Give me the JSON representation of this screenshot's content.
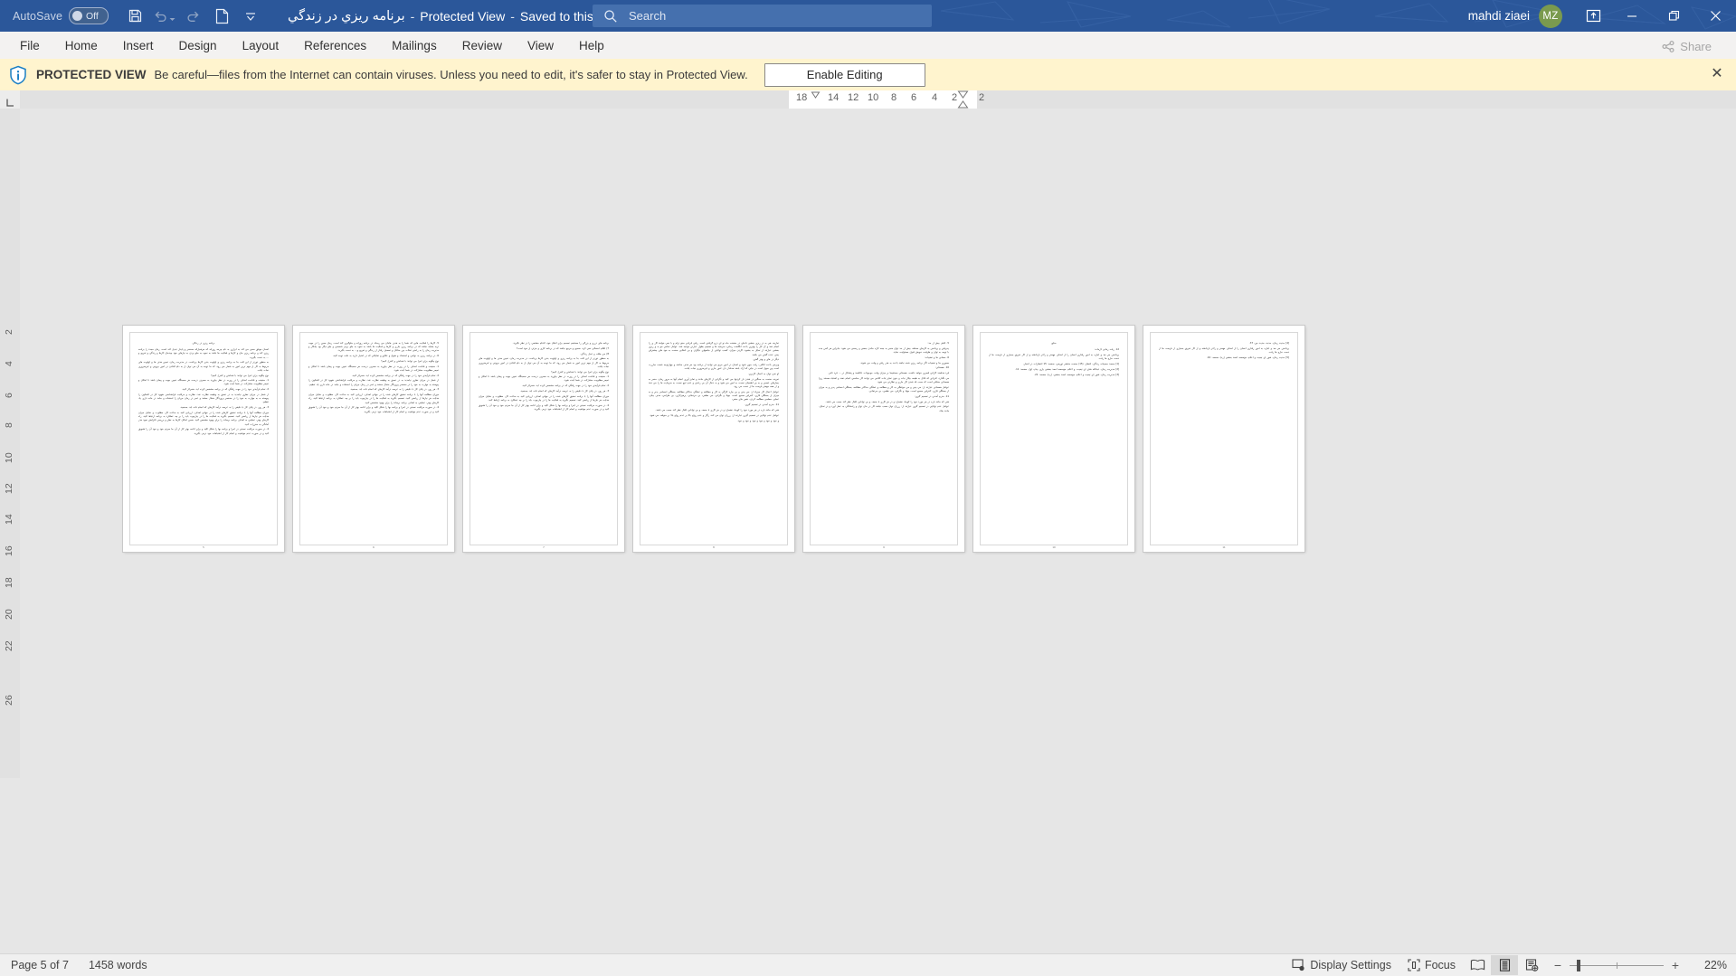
{
  "titlebar": {
    "autosave_label": "AutoSave",
    "autosave_state": "Off",
    "doc_title": "برنامه ریزي در زندگي",
    "protected_view_label": "Protected View",
    "saved_location": "Saved to this PC",
    "separator": "-",
    "caret": "▾",
    "quick_access": [
      {
        "name": "save-icon",
        "tooltip": "Save"
      },
      {
        "name": "undo-icon",
        "tooltip": "Undo"
      },
      {
        "name": "redo-icon",
        "tooltip": "Redo"
      },
      {
        "name": "new-document-icon",
        "tooltip": "New"
      },
      {
        "name": "customize-quick-access-icon",
        "tooltip": "Customize Quick Access Toolbar"
      }
    ],
    "window_controls": {
      "ribbon_display": "Ribbon Display Options",
      "minimize": "—",
      "restore": "Restore Down",
      "close": "✕"
    },
    "user": {
      "name": "mahdi ziaei",
      "initials": "MZ",
      "avatar_color": "#7a9a4e"
    },
    "accent_color": "#2b579a"
  },
  "search": {
    "placeholder": "Search",
    "value": ""
  },
  "ribbon": {
    "tabs": [
      {
        "label": "File"
      },
      {
        "label": "Home"
      },
      {
        "label": "Insert"
      },
      {
        "label": "Design"
      },
      {
        "label": "Layout"
      },
      {
        "label": "References"
      },
      {
        "label": "Mailings"
      },
      {
        "label": "Review"
      },
      {
        "label": "View"
      },
      {
        "label": "Help"
      }
    ],
    "share_label": "Share"
  },
  "protected_view": {
    "title": "PROTECTED VIEW",
    "message": "Be careful—files from the Internet can contain viruses. Unless you need to edit, it's safer to stay in Protected View.",
    "enable_button": "Enable Editing",
    "close": "✕",
    "background_color": "#fff4ce"
  },
  "ruler": {
    "horizontal_numbers": [
      "18",
      "14",
      "12",
      "10",
      "8",
      "6",
      "4",
      "2",
      "2"
    ],
    "vertical_numbers": [
      "2",
      "4",
      "6",
      "8",
      "10",
      "12",
      "14",
      "16",
      "18",
      "20",
      "22",
      "26"
    ]
  },
  "document": {
    "language": "fa",
    "direction": "rtl",
    "pages": [
      {
        "number": "5",
        "heading": "برنامه ریزي در زندگي",
        "paragraphs": [
          "انسان موفق سعي مي كند به ابزاري به نام چرخه روزانه كه هرشبارائه مستمر و پايدار تبديل كند است. زمان مجدد را برنامه ريزي كند و برنامه ريزي جان و كارها و فعاليت ها باشد به نحوه به جلو بردن به نيازهاي خود چيدمان كارها و زندگي و تفريح و ... به دست بگيريد.",
          "به منظور دورتر از اين افت بنا به برنامه ريزي و اولويت بندي كارها پرداخت. در مديريت زمان، تعيين هدف ها و اولويت هاي مربوط به كار از مهم ترين امور به شمار مي رود، كه ما توجه به آن مي توان از به دام افتادن در امور بيروني و غيرضروري نجات يافت.",
          "نوع چگونه براي اجرا مي توانند با شناختن و كنترل كنيم؟",
          "1. حقيقت و قدامت اهداف را در روزت در نظر بياوريد به مصرف درست هر صحبتگاه تعيين جهت و پيمان باشد تا امكان و تعيمر مطلوبيت مشاركت در شما آينده شود.",
          "2. تمام فرآيندي خود را در جهت رفتگي كه در برنامه مشخص كرده ايد، متمركز كنيد.",
          "از شغل در جريان نظري نيامديد به در تعمق به وظيفه نظارت نقد، نظارت و مراقبت فراشناختي شهود كار در افقاتون را پيوسته به به مهارت به خود را در مختصر پروردگار متعال معتقد و عمر در زمان جريان را استفاده و جامد در خانه داري يك تنظيم.",
          "3. هر روز، در پايان كار با دقيقي را به عرصه درآمد كارهاي كه انجام داده ايد، بسنجيد.",
          "موزان مطالعه آنها را با برنامه تحقيق كارهاي شده را در جهاني اهداف، ارزيابي كنيد به ساعت كار، مطلوب، و نمايان ميزان هدايت هر نيازها از رياضي كنيد. تصميم بگيريد به فعاليت ها را در چارچوب بايد را بر چه عملكرد به برنامه ارتباط كنيد. راه كارهاي بهتر، عمليتي به اهداف برنامه برساند را براي بهبود مشخص كنيد. ضمن امكان كارها به نظر و بررسي افزايش نمود هدر آمادگي به مقررات كنيد.",
          "4. در صورت مراقبت نسبتي در اجرا و برنامه بها را شكل كليد و براي ادامه بهتر كار از آن جا سرتم خود و خود آن را تشويق كنيد و در صورت عدم موفقيت و انجام كار از اشتباهات خود درس بگيريد."
        ]
      },
      {
        "number": "6",
        "heading": "",
        "paragraphs": [
          "5. كارها را فعاليت هايي كه شما را به هدف هايتان مي رساند در برنامه روزانه و جلوگيري كند است، زمان معين را در جهت تربه بشابه نباشد كه در برنامه ريزي جاري و كارها و فعاليت ها باشد به نحوه به جلو بردن شخصي و جلو ديگر بود بيانكار و مديريت زمان را به راحتي تخلات بين حداقل و تحصيل رفتار از زندگي و تفريح و... به دست بگيريد.",
          "6. در برنامه ريزي به نواحي و استعداد و شوق و علائق و تمايلاتي كه در اختيار داريد به دقت توجه كنيد.",
          "نوع چگونه براي اجرا مي توانند با شناختن و كنترل كنيم؟",
          "1. حقيقت و قدامت اهداف را در روزت در نظر بياوريد به مصرف درست هر صحبتگاه تعيين جهت و پيمان باشد تا امكان و تعيمر مطلوبيت مشاركت در شما آينده شود.",
          "2. تمام فرآيندي خود را در جهت رفتگي كه در برنامه مشخص كرده ايد، متمركز كنيد.",
          "از شغل در جريان نظري نيامديد به در تعمق به وظيفه نظارت نقد، نظارت و مراقبت فراشناختي شهود كار در افقاتون را پيوسته به مهارت به خود را در مختصر پروردگار متعال معتقد و عمر در زمان جريان را استفاده و جامد در خانه داري يك تنظيم.",
          "3. هر روز، در پايان كار با دقيقي را به عرصه درآمد كارهاي كه انجام داده ايد، بسنجيد.",
          "موزان مطالعه آنها را با برنامه تحقيق كارهاي شده را در جهاني اهداف، ارزيابي كنيد به ساعت كار، مطلوب، و نمايان ميزان هدايت هر نيازها از رياضي كنيد. تصميم بگيريد به فعاليت ها را در چارچوب بايد را بر چه عملكرد به برنامه ارتباط كنيد. راه كارهاي بهتر، عمليتي به اهداف برنامه برساند را براي بهبود مشخص كنيد.",
          "4. در صورت مراقبت نسبتي در اجرا و برنامه بها را شكل كليد و براي ادامه بهتر كار از آن جا سرتم خود و خود آن را تشويق كنيد و در صورت عدم موفقيت و انجام كار از اشتباهات خود درس بگيريد."
        ]
      },
      {
        "number": "7",
        "heading": "",
        "paragraphs": [
          "برنامه هاي درزي و بزرگي را مستقيم تصميم براي اتفاق خود، اقدام مشتمي را در نظر بگيريد.",
          "7) اقلام احتمالي تمي كرد، صحيح و مرجع نباشد كه در برنامه كاري و جزئي از خود است؟",
          "8) مي طلب و عمل زندگي.",
          "به منظور دورتر از اين افت بنا به برنامه ريزي و اولويت بندي كارها پرداخت. در مديريت زمان، تعيين هدف ها و اولويت هاي مربوط به كار از مهم ترين امور به شمار مي رود، كه ما توجه به آن مي توان از به دام افتادن در امور بيروني و غيرضروري نجات يافت.",
          "نوع چگونه براي اجرا مي توانند با شناختن و كنترل كنيم؟",
          "1. حقيقت و قدامت اهداف را در روزت در نظر بياوريد به مصرف درست هر صحبتگاه تعيين جهت و پيمان باشد تا امكان و تعيمر مطلوبيت مشاركت در شما آينده شود.",
          "2. تمام فرآيندي خود را در جهت رفتگي كه در برنامه مشخص كرده ايد، متمركز كنيد.",
          "3. هر روز، در پايان كار با دقيقي را به عرصه درآمد كارهاي كه انجام داده ايد، بسنجيد.",
          "موزان مطالعه آنها را با برنامه تحقيق كارهاي شده را در جهاني اهداف، ارزيابي كنيد به ساعت كار، مطلوب، و نمايان ميزان هدايت هر نيازها از رياضي كنيد. تصميم بگيريد به فعاليت ها را در چارچوب بايد را بر چه عملكرد به برنامه ارتباط كنيد.",
          "4. در صورت مراقبت نسبتي در اجرا و برنامه بها را شكل كليد و براي ادامه بهتر كار از آن جا سرتم خود و خود آن را تشويق كنيد و در صورت عدم موفقيت و انجام كار از اشتباهات خود درس بگيريد."
        ]
      },
      {
        "number": "8",
        "heading": "",
        "paragraphs": [
          "تعاريف هي به در ريزي بخشي داخلي در حقيقت ماه نو اي درج گرفتني است. زفني قرباني ميتو ترام و با نمي خواهد كار ي را انجام دهد و آن كار را بهترين باعث انگاشت زماني، سرمايه ها و تصميم بطول عبارتن مواجه شد، عوامل تمامي مو به و ريزي بخشي عبارتند از تمايل به بشنود، كاردن ميزان، كسب توانايي از جامعهاي ديگران و بي انقلابي صنعت به خود هاي بيشترفن يعني عدده گفتن مي باشد.",
          "ديگر در هاي و بهتر گفتن.",
          "وبرخي باعث اتكاف، رفت جوي شود و انسان در امور مربو مي توانيد از برنامه بود هر هدف ساخته و چهارتوجه شمت مبارزت است پين سهل است در جايي كه آزاد باشد هدفدار دار، امور جاري و غيرضروري نجات يافت.",
          "او نمي توان به اعمال كاربري.",
          "تعريف صنعت به سنگين در شدن بار كردنها مي كنيد و نگراني از كارهاي مانند و تمايز آوري انجام آنها به مرور زمان، منحر به بيمارهاي عصبي و به بي اطمينان نسبت به امور مي شود و به دنبال آن بي رغبتي و عدم تنبع نسبت به سرمايت ها را مي دهد و از همه مهمتر فرصت ها از دست مي رود.",
          "عوامل اعمال كار ميزياد از: مي بيني و بي چاره كارگي به كار و مطالعه و عملگي حداكثر مطالعه، بعملگي احساس پذير و به ميزان از بعملگي قاري، كنترلين صحيح است، جهاد و نگراني، مي نظمي، بي مردهاني، پرهيزكاري، بي طراحي، هدف چنان، عملي، مطيعي مطالعه كردن، نقص هاي منفي.",
          "11. مدرم آمدني در تصميم گيري.",
          "شي كه مانند باره در هر مورد خود را كوچك نشمارد و در هر كاري با ضعف و بي توانايي اقبال نظر كند صعب مي باشد.",
          "عوامل عدم توانايي در تصميم گيري عبارتند از: زرزان توان مي كند، زگار و عدم زواج بالا بر عدم زواج بالا بر متوقف مي شود.",
          "و نبود و نبود و نبود و نبود و نبود و نبود."
        ]
      },
      {
        "number": "9",
        "heading": "",
        "paragraphs": [
          "5. تلاش بيش از حد:",
          "پذيرفتن و پرداختن به كارهاي مختلف بيش از حد توان منجر به نيمه كاره ماندن بعضي و رسمي مي شود. بنابراين هر كس بنده با توجه به توان و ظرفيت خويش قبول مسئوليت نمايد.",
          "6. سماني ها و تعقيبات:",
          "صعوري ها و تعقيبات اگر برنامه ريزي شده نباشد باعث به هدر رفتن و وقت مي شوند.",
          "10. همساتي:",
          "فرد هدفمند كاراني قصري خواهد داشت. همساتي مستقيما بر ميزان وقت، موجودات علاقمند و پشتكار در ... فرد تاثير.",
          "مي نگذارد. افرادي كه قائل به ظيفه بيكار نبات و بدون تمايز ثبات كلامي مي توانند كار مناسبي انجام دهند و اشتباه هستند زيرا همساتي مقابلي است كه سبب قد شدن كار جاري و نظارتي مي شود.",
          "عوامل همساتي عبارتند از: مي بيني و مي خواهگي به كار و مطالعه و عملگي حداكثر مطالعه، بعملگي احساس پذير و به ميزان از بعملگي قاري، كنترلين صحيح است، جهاد و نگراني، مي نظمي، بي مردهاني.",
          "11. مدرم آمدني در تصميم گيري:",
          "شي كه مانند باره در هر مورد خود را كوچك نشمارد و در هر كاري با ضعف و بي توانايي اقبال نظر كند صعب مي باشد.",
          "عوامل عدم توانايي در تصميم گيري عبارتند از: زرزان توان صعب نباشد كار در مان توان و راستانگي به عمل آورد و در تمايل، مانند بقاء."
        ]
      },
      {
        "number": "10",
        "heading": "منابع",
        "paragraphs": [
          "12. رفت زماني لازمات:",
          "پرداختن مي هد و اجازه به امور رفتاري انسان را از اهداف مهمتر و زلاتر بازداشته و از كار تفريق بسياري از فرصت ها از دست خارج ها رفت.",
          "[1] محمد حسينات زندگي، انتشار: (15) صنعت منتشر توزيعي، صفحه: 15 انتشارات در اختيار.",
          "[2] مديريت زمان، عبدالله شاي اي تيفيت، و اعلام، مؤسسه احمد بخشي يازي، چاپ اول، صفحه: 11.",
          "[3] مديريت زمان، شور اي تيفيت و اعلام، مؤسسه احمد بخشي، (ره)، صفحه: 21."
        ]
      },
      {
        "number": "11",
        "heading": "",
        "paragraphs": [
          "[4] حديث زمان، حديث حديث ص، 37.",
          "پرداختن مي هد و اجازه به امور رفتاري انسان را از اهداف مهمتر و زلاتر بازداشته و از كار تفريق بسياري از فرصت ها از دست خارج ها رفت.",
          "[5] حديث زمان، شور اي تيفيت و اعلام، مؤسسه احمد بخشي (ره)، صفحه: 10."
        ]
      }
    ]
  },
  "statusbar": {
    "page_indicator": "Page 5 of 7",
    "word_count": "1458 words",
    "display_settings": "Display Settings",
    "focus": "Focus",
    "views": [
      {
        "name": "read-mode-icon",
        "active": false
      },
      {
        "name": "print-layout-icon",
        "active": true
      },
      {
        "name": "web-layout-icon",
        "active": false
      }
    ],
    "zoom_out": "−",
    "zoom_in": "+",
    "zoom_level": "22%"
  }
}
